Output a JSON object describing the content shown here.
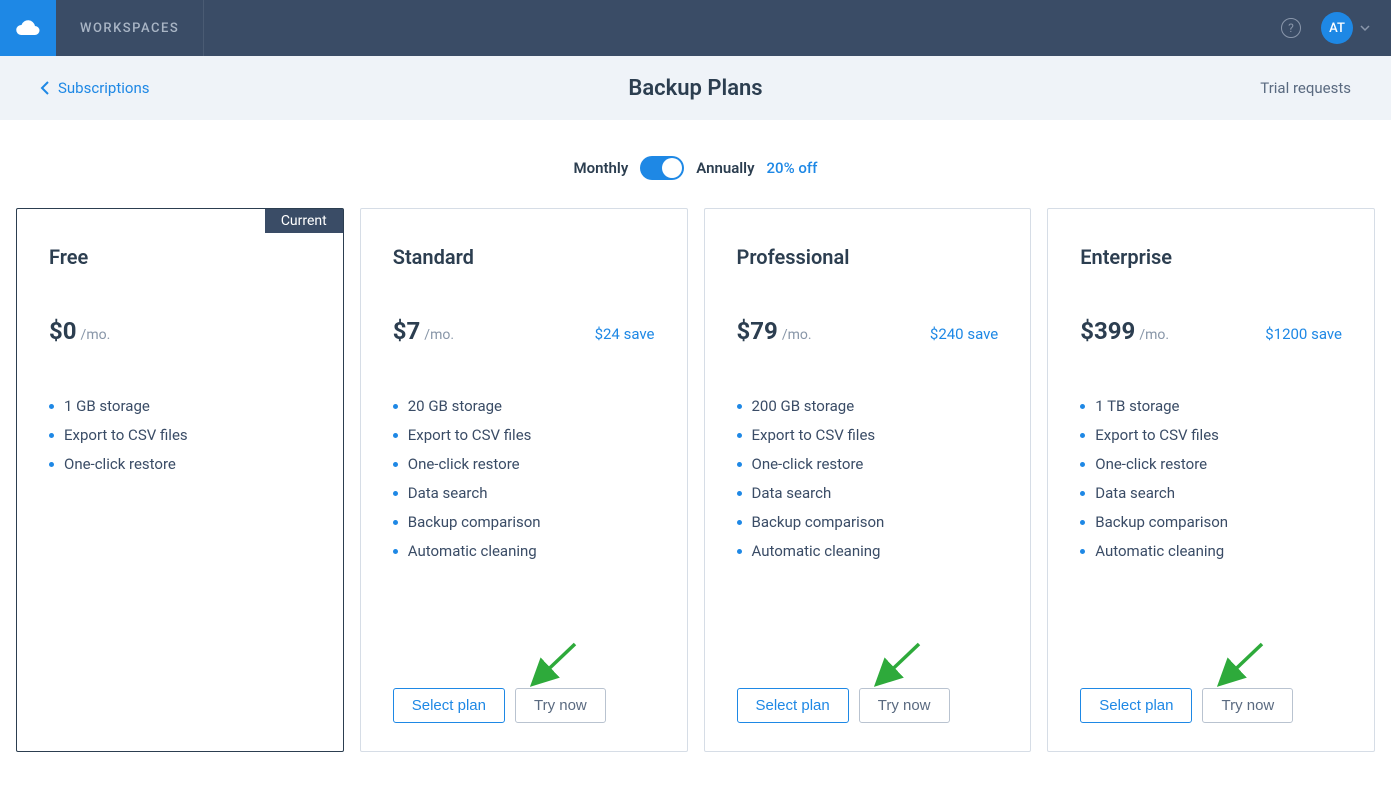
{
  "header": {
    "workspaces_label": "WORKSPACES",
    "avatar_initials": "AT"
  },
  "subheader": {
    "back_label": "Subscriptions",
    "page_title": "Backup Plans",
    "trial_requests_label": "Trial requests"
  },
  "billing_toggle": {
    "monthly_label": "Monthly",
    "annually_label": "Annually",
    "discount_label": "20% off"
  },
  "current_tag": "Current",
  "per_month": "/mo.",
  "buttons": {
    "select_plan": "Select plan",
    "try_now": "Try now"
  },
  "plans": [
    {
      "name": "Free",
      "price": "$0",
      "save": "",
      "current": true,
      "features": [
        "1 GB storage",
        "Export to CSV files",
        "One-click restore"
      ]
    },
    {
      "name": "Standard",
      "price": "$7",
      "save": "$24 save",
      "current": false,
      "features": [
        "20 GB storage",
        "Export to CSV files",
        "One-click restore",
        "Data search",
        "Backup comparison",
        "Automatic cleaning"
      ]
    },
    {
      "name": "Professional",
      "price": "$79",
      "save": "$240 save",
      "current": false,
      "features": [
        "200 GB storage",
        "Export to CSV files",
        "One-click restore",
        "Data search",
        "Backup comparison",
        "Automatic cleaning"
      ]
    },
    {
      "name": "Enterprise",
      "price": "$399",
      "save": "$1200 save",
      "current": false,
      "features": [
        "1 TB storage",
        "Export to CSV files",
        "One-click restore",
        "Data search",
        "Backup comparison",
        "Automatic cleaning"
      ]
    }
  ]
}
